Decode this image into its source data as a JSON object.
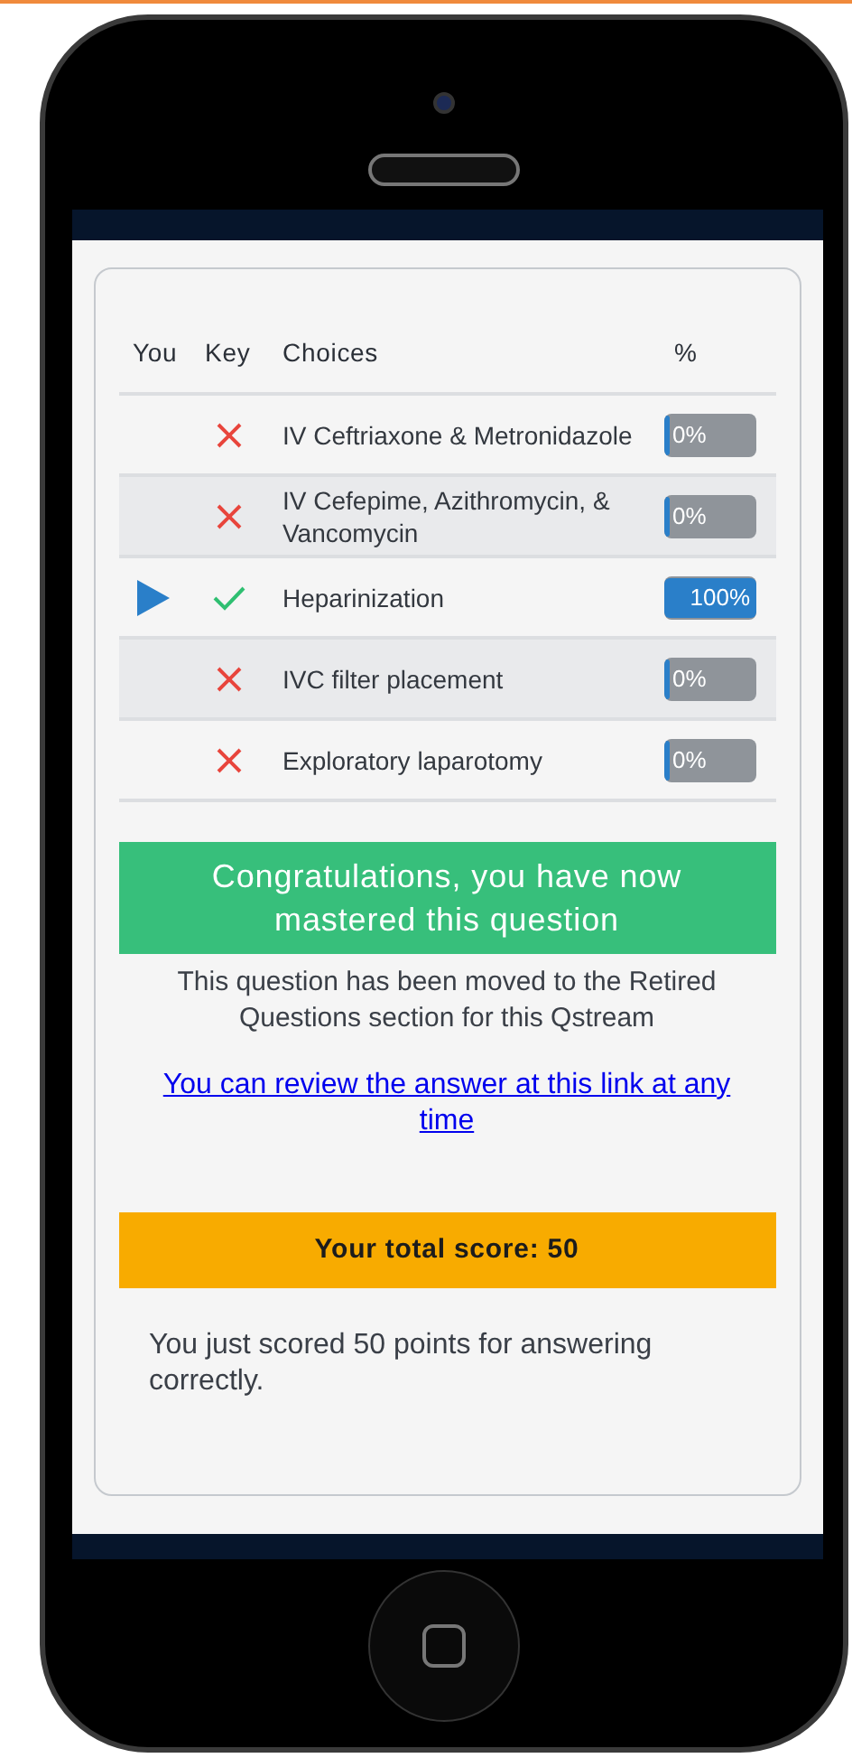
{
  "table": {
    "columns": [
      "You",
      "Key",
      "Choices",
      "%"
    ],
    "rows": [
      {
        "selected": false,
        "correct": false,
        "choice": "IV Ceftriaxone & Metronidazole",
        "percent": "0%",
        "level": 0
      },
      {
        "selected": false,
        "correct": false,
        "choice": "IV Cefepime, Azithromycin, & Vancomycin",
        "percent": "0%",
        "level": 0
      },
      {
        "selected": true,
        "correct": true,
        "choice": "Heparinization",
        "percent": "100%",
        "level": 1
      },
      {
        "selected": false,
        "correct": false,
        "choice": "IVC filter placement",
        "percent": "0%",
        "level": 0
      },
      {
        "selected": false,
        "correct": false,
        "choice": "Exploratory laparotomy",
        "percent": "0%",
        "level": 0
      }
    ]
  },
  "banner": "Congratulations, you have now mastered this question",
  "note": "This question has been moved to the Retired Questions section for this Qstream",
  "link": "You can review the answer at this link at any time",
  "score": "Your total score: 50",
  "points": "You just scored 50 points for answering correctly."
}
